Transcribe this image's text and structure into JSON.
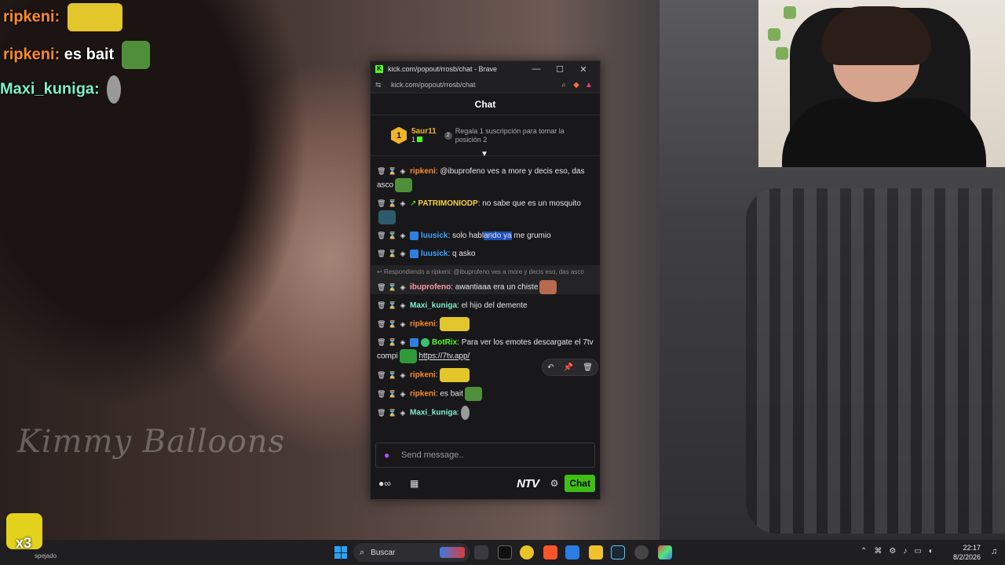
{
  "overlay_chat": [
    {
      "user": "ripkeni",
      "sep": ":",
      "message": ""
    },
    {
      "user": "ripkeni",
      "sep": ":",
      "message": " es bait"
    },
    {
      "user": "Maxi_kuniga",
      "sep": ":",
      "message": ""
    }
  ],
  "watermark": "Kimmy Balloons",
  "window": {
    "title": "kick.com/popout/rrosb/chat - Brave",
    "url": "kick.com/popout/rrosb/chat",
    "minimize": "—",
    "maximize": "☐",
    "close": "✕"
  },
  "chat": {
    "header": "Chat",
    "top_gifter": {
      "rank": "1",
      "name": "5aur11",
      "count": "1",
      "note": "Regala 1 suscripción para tomar la posición 2"
    },
    "messages": [
      {
        "user": "ripkeni",
        "text": ": @ibuprofeno ves a more y decis eso, das asco"
      },
      {
        "user": "PATRIMONIODP",
        "text": ": no sabe que es un mosquito"
      },
      {
        "user": "luusick",
        "text_before": ": solo habl",
        "highlight": "ando ya",
        "text_after": " me grumio"
      },
      {
        "user": "luusick",
        "text": ": q asko"
      },
      {
        "reply_ref": "Respondiendo a ripkeni: @ibuprofeno ves a more y decis eso, das asco",
        "user": "ibuprofeno",
        "text": ": awantiaaa era un chiste"
      },
      {
        "user": "Maxi_kuniga",
        "text": ": el hijo del demente"
      },
      {
        "user": "ripkeni",
        "text": ":"
      },
      {
        "user": "BotRix",
        "text": ": Para ver los emotes descargate el 7tv compi",
        "link": "https://7tv.app/"
      },
      {
        "user": "ripkeni",
        "text": ":"
      },
      {
        "user": "ripkeni",
        "text": ": es bait"
      },
      {
        "user": "Maxi_kuniga",
        "text": ":"
      }
    ],
    "input_placeholder": "Send message..",
    "ntv_label": "NTV",
    "send_label": "Chat"
  },
  "taskbar": {
    "left_text": "spejado",
    "left_overlay": "x3",
    "search_label": "Buscar",
    "time": "22:17",
    "date": "8/2/2026"
  },
  "colors": {
    "kick_green": "#53fc18",
    "username_orange": "#ff8a2a",
    "username_mint": "#7ff0c8",
    "highlight_blue": "#1f4fb8"
  }
}
